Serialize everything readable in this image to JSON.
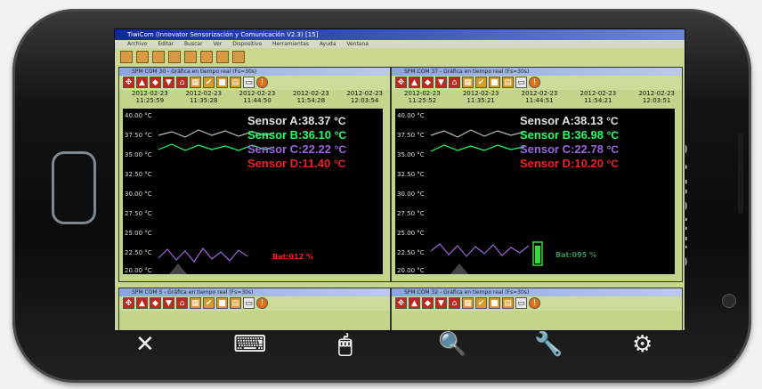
{
  "device": {
    "brand": "SAMSUNG"
  },
  "app": {
    "title": "TiwiCom (Innovator Sensorización y Comunicación V2.3) [15]",
    "menu": [
      "Archivo",
      "Editar",
      "Buscar",
      "Ver",
      "Dispositivo",
      "Herramientas",
      "Ayuda",
      "Ventana"
    ]
  },
  "windows": [
    {
      "title": "SPM COM 30 - Gráfica en tiempo real (Fs=30s)",
      "dates": [
        {
          "date": "2012-02-23",
          "time": "11:25:59"
        },
        {
          "date": "2012-02-23",
          "time": "11:35:28"
        },
        {
          "date": "2012-02-23",
          "time": "11:44:50"
        },
        {
          "date": "2012-02-23",
          "time": "11:54:28"
        },
        {
          "date": "2012-02-23",
          "time": "12:03:54"
        }
      ],
      "yticks": [
        "40.00 °C",
        "37.50 °C",
        "35.00 °C",
        "32.50 °C",
        "30.00 °C",
        "27.50 °C",
        "25.00 °C",
        "22.50 °C",
        "20.00 °C"
      ],
      "sensors": [
        {
          "label": "Sensor A:38.37",
          "unit": "°C",
          "color": "#e0e0e0"
        },
        {
          "label": "Sensor B:36.10",
          "unit": "°C",
          "color": "#22ff66"
        },
        {
          "label": "Sensor C:22.22",
          "unit": "°C",
          "color": "#9966dd"
        },
        {
          "label": "Sensor D:11.40",
          "unit": "°C",
          "color": "#ee2222"
        }
      ],
      "battery": "Bat:012 %",
      "battery_color": "#ff2020"
    },
    {
      "title": "SPM COM 37 - Gráfica en tiempo real (Fs=30s)",
      "dates": [
        {
          "date": "2012-02-23",
          "time": "11:25:52"
        },
        {
          "date": "2012-02-23",
          "time": "11:35:21"
        },
        {
          "date": "2012-02-23",
          "time": "11:44:51"
        },
        {
          "date": "2012-02-23",
          "time": "11:54:21"
        },
        {
          "date": "2012-02-23",
          "time": "12:03:51"
        }
      ],
      "yticks": [
        "40.00 °C",
        "37.50 °C",
        "35.00 °C",
        "32.50 °C",
        "30.00 °C",
        "27.50 °C",
        "25.00 °C",
        "22.50 °C",
        "20.00 °C"
      ],
      "sensors": [
        {
          "label": "Sensor A:38.13",
          "unit": "°C",
          "color": "#e0e0e0"
        },
        {
          "label": "Sensor B:36.98",
          "unit": "°C",
          "color": "#22ff66"
        },
        {
          "label": "Sensor C:22.78",
          "unit": "°C",
          "color": "#9966dd"
        },
        {
          "label": "Sensor D:10.20",
          "unit": "°C",
          "color": "#ee2222"
        }
      ],
      "battery": "Bat:095 %",
      "battery_color": "#3a8a5a"
    },
    {
      "title": "SPM COM 5 - Gráfica en tiempo real (Fs=30s)"
    },
    {
      "title": "SPM COM 32 - Gráfica en tiempo real (Fs=30s)"
    }
  ],
  "softkeys": [
    {
      "name": "close-icon",
      "glyph": "✕"
    },
    {
      "name": "keyboard-icon",
      "glyph": "⌨"
    },
    {
      "name": "mouse-icon",
      "glyph": "🖱"
    },
    {
      "name": "search-icon",
      "glyph": "🔍"
    },
    {
      "name": "wrench-icon",
      "glyph": "🔧"
    },
    {
      "name": "gear-icon",
      "glyph": "⚙"
    }
  ]
}
